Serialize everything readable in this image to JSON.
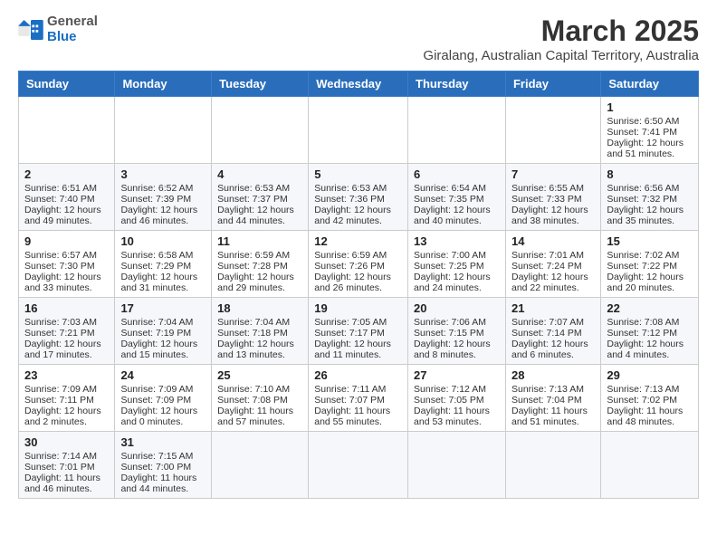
{
  "logo": {
    "text_general": "General",
    "text_blue": "Blue"
  },
  "title": "March 2025",
  "subtitle": "Giralang, Australian Capital Territory, Australia",
  "weekdays": [
    "Sunday",
    "Monday",
    "Tuesday",
    "Wednesday",
    "Thursday",
    "Friday",
    "Saturday"
  ],
  "weeks": [
    [
      {
        "day": null
      },
      {
        "day": null
      },
      {
        "day": null
      },
      {
        "day": null
      },
      {
        "day": null
      },
      {
        "day": null
      },
      {
        "day": "1",
        "sunrise": "6:50 AM",
        "sunset": "7:41 PM",
        "daylight": "12 hours and 51 minutes."
      }
    ],
    [
      {
        "day": "2",
        "sunrise": "6:51 AM",
        "sunset": "7:40 PM",
        "daylight": "12 hours and 49 minutes."
      },
      {
        "day": "3",
        "sunrise": "6:52 AM",
        "sunset": "7:39 PM",
        "daylight": "12 hours and 46 minutes."
      },
      {
        "day": "4",
        "sunrise": "6:53 AM",
        "sunset": "7:37 PM",
        "daylight": "12 hours and 44 minutes."
      },
      {
        "day": "5",
        "sunrise": "6:53 AM",
        "sunset": "7:36 PM",
        "daylight": "12 hours and 42 minutes."
      },
      {
        "day": "6",
        "sunrise": "6:54 AM",
        "sunset": "7:35 PM",
        "daylight": "12 hours and 40 minutes."
      },
      {
        "day": "7",
        "sunrise": "6:55 AM",
        "sunset": "7:33 PM",
        "daylight": "12 hours and 38 minutes."
      },
      {
        "day": "8",
        "sunrise": "6:56 AM",
        "sunset": "7:32 PM",
        "daylight": "12 hours and 35 minutes."
      }
    ],
    [
      {
        "day": "9",
        "sunrise": "6:57 AM",
        "sunset": "7:30 PM",
        "daylight": "12 hours and 33 minutes."
      },
      {
        "day": "10",
        "sunrise": "6:58 AM",
        "sunset": "7:29 PM",
        "daylight": "12 hours and 31 minutes."
      },
      {
        "day": "11",
        "sunrise": "6:59 AM",
        "sunset": "7:28 PM",
        "daylight": "12 hours and 29 minutes."
      },
      {
        "day": "12",
        "sunrise": "6:59 AM",
        "sunset": "7:26 PM",
        "daylight": "12 hours and 26 minutes."
      },
      {
        "day": "13",
        "sunrise": "7:00 AM",
        "sunset": "7:25 PM",
        "daylight": "12 hours and 24 minutes."
      },
      {
        "day": "14",
        "sunrise": "7:01 AM",
        "sunset": "7:24 PM",
        "daylight": "12 hours and 22 minutes."
      },
      {
        "day": "15",
        "sunrise": "7:02 AM",
        "sunset": "7:22 PM",
        "daylight": "12 hours and 20 minutes."
      }
    ],
    [
      {
        "day": "16",
        "sunrise": "7:03 AM",
        "sunset": "7:21 PM",
        "daylight": "12 hours and 17 minutes."
      },
      {
        "day": "17",
        "sunrise": "7:04 AM",
        "sunset": "7:19 PM",
        "daylight": "12 hours and 15 minutes."
      },
      {
        "day": "18",
        "sunrise": "7:04 AM",
        "sunset": "7:18 PM",
        "daylight": "12 hours and 13 minutes."
      },
      {
        "day": "19",
        "sunrise": "7:05 AM",
        "sunset": "7:17 PM",
        "daylight": "12 hours and 11 minutes."
      },
      {
        "day": "20",
        "sunrise": "7:06 AM",
        "sunset": "7:15 PM",
        "daylight": "12 hours and 8 minutes."
      },
      {
        "day": "21",
        "sunrise": "7:07 AM",
        "sunset": "7:14 PM",
        "daylight": "12 hours and 6 minutes."
      },
      {
        "day": "22",
        "sunrise": "7:08 AM",
        "sunset": "7:12 PM",
        "daylight": "12 hours and 4 minutes."
      }
    ],
    [
      {
        "day": "23",
        "sunrise": "7:09 AM",
        "sunset": "7:11 PM",
        "daylight": "12 hours and 2 minutes."
      },
      {
        "day": "24",
        "sunrise": "7:09 AM",
        "sunset": "7:09 PM",
        "daylight": "12 hours and 0 minutes."
      },
      {
        "day": "25",
        "sunrise": "7:10 AM",
        "sunset": "7:08 PM",
        "daylight": "11 hours and 57 minutes."
      },
      {
        "day": "26",
        "sunrise": "7:11 AM",
        "sunset": "7:07 PM",
        "daylight": "11 hours and 55 minutes."
      },
      {
        "day": "27",
        "sunrise": "7:12 AM",
        "sunset": "7:05 PM",
        "daylight": "11 hours and 53 minutes."
      },
      {
        "day": "28",
        "sunrise": "7:13 AM",
        "sunset": "7:04 PM",
        "daylight": "11 hours and 51 minutes."
      },
      {
        "day": "29",
        "sunrise": "7:13 AM",
        "sunset": "7:02 PM",
        "daylight": "11 hours and 48 minutes."
      }
    ],
    [
      {
        "day": "30",
        "sunrise": "7:14 AM",
        "sunset": "7:01 PM",
        "daylight": "11 hours and 46 minutes."
      },
      {
        "day": "31",
        "sunrise": "7:15 AM",
        "sunset": "7:00 PM",
        "daylight": "11 hours and 44 minutes."
      },
      {
        "day": null
      },
      {
        "day": null
      },
      {
        "day": null
      },
      {
        "day": null
      },
      {
        "day": null
      }
    ]
  ],
  "labels": {
    "sunrise": "Sunrise:",
    "sunset": "Sunset:",
    "daylight": "Daylight:"
  }
}
